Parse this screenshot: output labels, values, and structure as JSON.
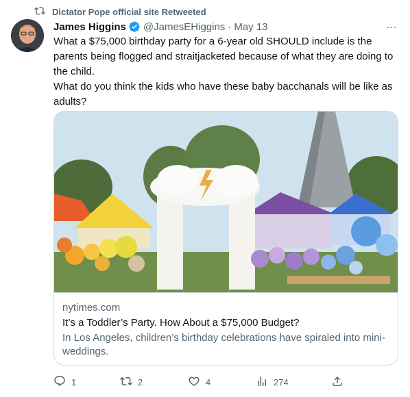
{
  "retweet": {
    "text": "Dictator Pope official site Retweeted",
    "icon": "retweet-icon"
  },
  "tweet": {
    "author_name": "James Higgins",
    "handle": "@JamesEHiggins",
    "separator": "·",
    "time": "May 13",
    "more": "···",
    "text": "What a $75,000 birthday party for a 6-year old SHOULD include is the parents being flogged and straitjacketed because of what they are doing to the child.\nWhat do you think the kids who have these baby bacchanals will be like as adults?"
  },
  "card": {
    "domain": "nytimes.com",
    "title": "It’s a Toddler’s Party. How About a $75,000 Budget?",
    "description": "In Los Angeles, children’s birthday celebrations have spiraled into mini-weddings."
  },
  "actions": {
    "replies": "1",
    "retweets": "2",
    "likes": "4",
    "views": "274"
  },
  "colors": {
    "verified": "#1d9bf0",
    "secondary_text": "#536471",
    "border": "#cfd9de"
  }
}
